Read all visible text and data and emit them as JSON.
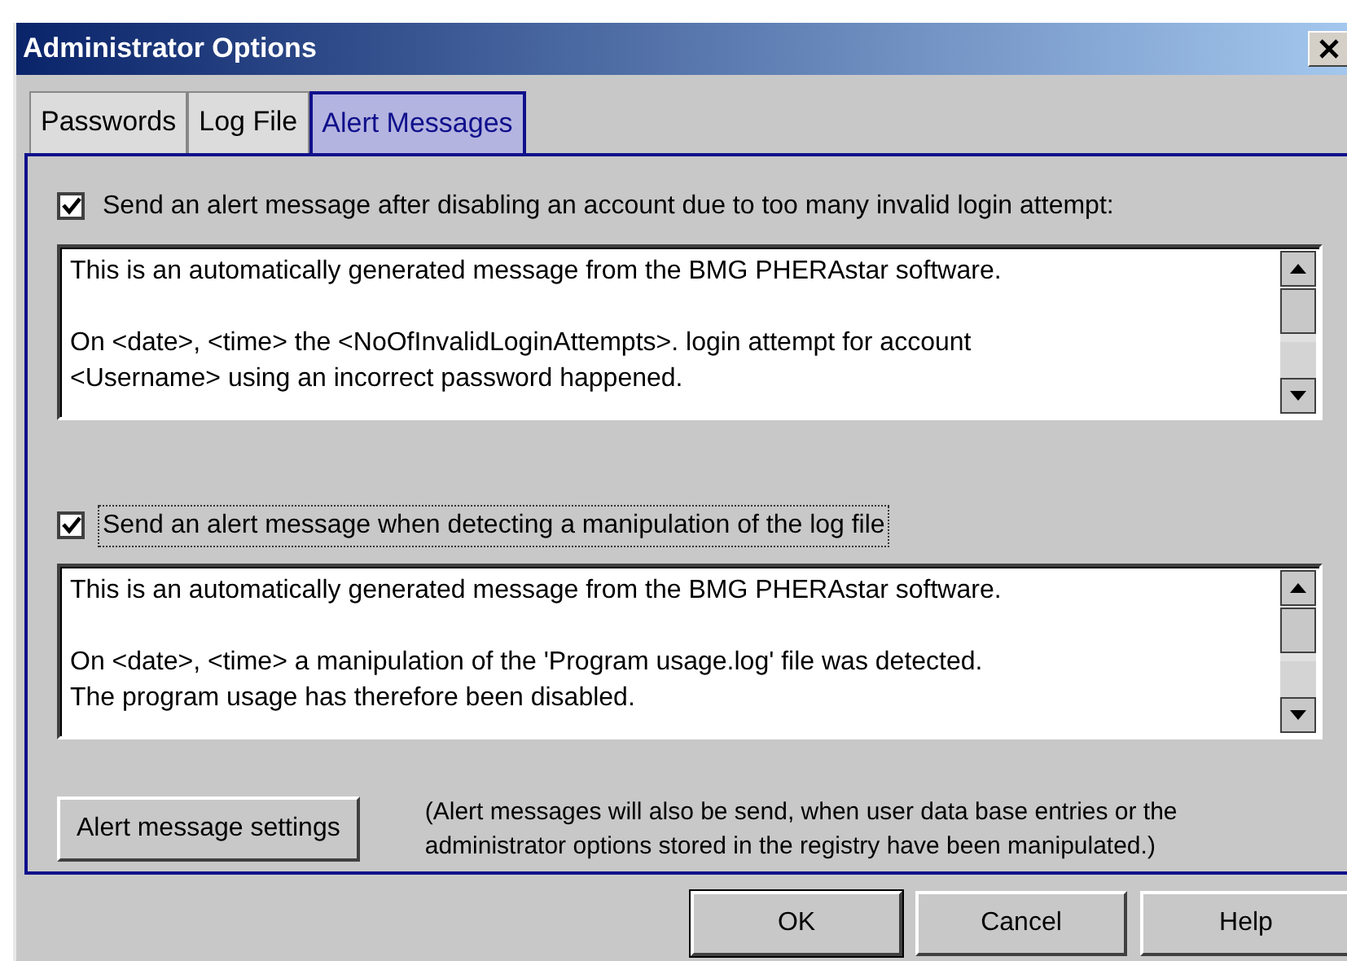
{
  "window": {
    "title": "Administrator Options"
  },
  "tabs": [
    {
      "label": "Passwords",
      "selected": false
    },
    {
      "label": "Log File",
      "selected": false
    },
    {
      "label": "Alert Messages",
      "selected": true
    }
  ],
  "alerts": [
    {
      "label": "Send an alert message after disabling an account due to too many invalid login attempt:",
      "checked": true,
      "focused": false,
      "message": "This is an automatically generated message from the BMG PHERAstar software.\n\nOn <date>, <time> the <NoOfInvalidLoginAttempts>. login attempt for account\n<Username> using an incorrect password happened."
    },
    {
      "label": "Send an alert message when detecting a manipulation of the log file",
      "checked": true,
      "focused": true,
      "message": "This is an automatically generated message from the BMG PHERAstar software.\n\nOn <date>, <time> a manipulation of the 'Program usage.log' file was detected.\nThe program usage has therefore been disabled."
    }
  ],
  "settings_button": "Alert message settings",
  "note": "(Alert messages will also be send, when user data base entries or the administrator options stored in the registry have been manipulated.)",
  "buttons": [
    {
      "label": "OK",
      "default": true
    },
    {
      "label": "Cancel",
      "default": false
    },
    {
      "label": "Help",
      "default": false
    }
  ]
}
